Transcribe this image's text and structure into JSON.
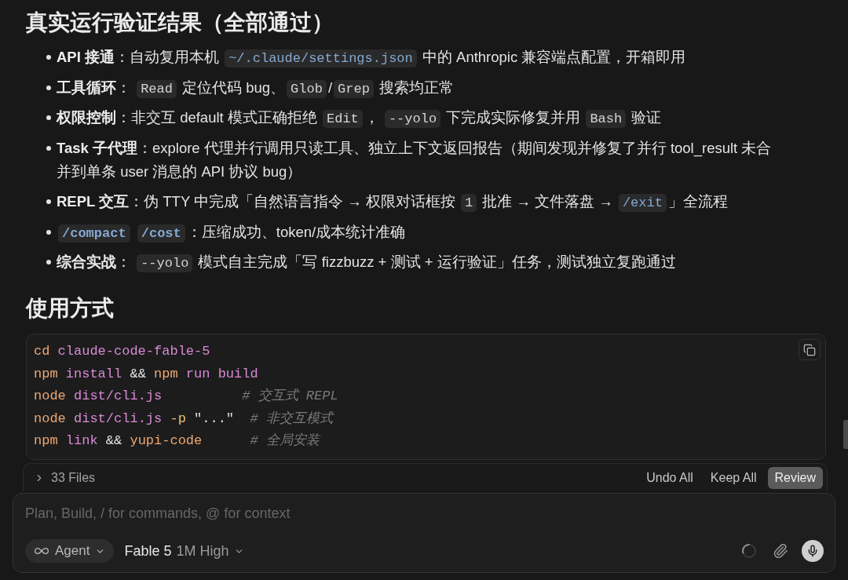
{
  "results": {
    "heading": "真实运行验证结果（全部通过）",
    "items": [
      {
        "segments": [
          {
            "kind": "label",
            "text": "API 接通"
          },
          {
            "kind": "text",
            "text": "：自动复用本机 "
          },
          {
            "kind": "code",
            "text": "~/.claude/settings.json",
            "accent": true
          },
          {
            "kind": "text",
            "text": " 中的 Anthropic 兼容端点配置，开箱即用"
          }
        ]
      },
      {
        "segments": [
          {
            "kind": "label",
            "text": "工具循环"
          },
          {
            "kind": "text",
            "text": "： "
          },
          {
            "kind": "code",
            "text": "Read",
            "accent": false
          },
          {
            "kind": "text",
            "text": " 定位代码 bug、"
          },
          {
            "kind": "code",
            "text": "Glob",
            "accent": false
          },
          {
            "kind": "text",
            "text": "/"
          },
          {
            "kind": "code",
            "text": "Grep",
            "accent": false
          },
          {
            "kind": "text",
            "text": " 搜索均正常"
          }
        ]
      },
      {
        "segments": [
          {
            "kind": "label",
            "text": "权限控制"
          },
          {
            "kind": "text",
            "text": "：非交互 default 模式正确拒绝 "
          },
          {
            "kind": "code",
            "text": "Edit",
            "accent": false
          },
          {
            "kind": "text",
            "text": "， "
          },
          {
            "kind": "code",
            "text": "--yolo",
            "accent": false
          },
          {
            "kind": "text",
            "text": " 下完成实际修复并用 "
          },
          {
            "kind": "code",
            "text": "Bash",
            "accent": false
          },
          {
            "kind": "text",
            "text": " 验证"
          }
        ]
      },
      {
        "segments": [
          {
            "kind": "label",
            "text": "Task 子代理"
          },
          {
            "kind": "text",
            "text": "：explore 代理并行调用只读工具、独立上下文返回报告（期间发现并修复了并行 tool_result 未合并到单条 user 消息的 API 协议 bug）"
          }
        ]
      },
      {
        "segments": [
          {
            "kind": "label",
            "text": "REPL 交互"
          },
          {
            "kind": "text",
            "text": "：伪 TTY 中完成「自然语言指令 → 权限对话框按 "
          },
          {
            "kind": "code",
            "text": "1",
            "accent": false
          },
          {
            "kind": "text",
            "text": " 批准 → 文件落盘 → "
          },
          {
            "kind": "code",
            "text": "/exit",
            "accent": true
          },
          {
            "kind": "text",
            "text": "」全流程"
          }
        ]
      },
      {
        "segments": [
          {
            "kind": "label_code",
            "text": "/compact",
            "accent": true
          },
          {
            "kind": "label_code",
            "text": "/cost",
            "accent": true
          },
          {
            "kind": "text",
            "text": "：压缩成功、token/成本统计准确"
          }
        ]
      },
      {
        "segments": [
          {
            "kind": "label",
            "text": "综合实战"
          },
          {
            "kind": "text",
            "text": "： "
          },
          {
            "kind": "code",
            "text": "--yolo",
            "accent": false
          },
          {
            "kind": "text",
            "text": " 模式自主完成「写 fizzbuzz + 测试 + 运行验证」任务，测试独立复跑通过"
          }
        ]
      }
    ]
  },
  "usage": {
    "heading": "使用方式",
    "code_block": {
      "lines": [
        {
          "tokens": [
            {
              "kind": "command",
              "text": "cd"
            },
            {
              "kind": "argument",
              "text": " claude-code-fable-5"
            }
          ]
        },
        {
          "tokens": [
            {
              "kind": "command",
              "text": "npm"
            },
            {
              "kind": "argument",
              "text": " install"
            },
            {
              "kind": "operator",
              "text": " &&"
            },
            {
              "kind": "command",
              "text": " npm"
            },
            {
              "kind": "argument",
              "text": " run build"
            }
          ]
        },
        {
          "tokens": [
            {
              "kind": "command",
              "text": "node"
            },
            {
              "kind": "argument",
              "text": " dist/cli.js"
            },
            {
              "kind": "comment",
              "text": "          # 交互式 REPL"
            }
          ]
        },
        {
          "tokens": [
            {
              "kind": "command",
              "text": "node"
            },
            {
              "kind": "argument",
              "text": " dist/cli.js"
            },
            {
              "kind": "flag",
              "text": " -p"
            },
            {
              "kind": "string",
              "text": " \"...\""
            },
            {
              "kind": "comment",
              "text": "  # 非交互模式"
            }
          ]
        },
        {
          "tokens": [
            {
              "kind": "command",
              "text": "npm"
            },
            {
              "kind": "argument",
              "text": " link"
            },
            {
              "kind": "operator",
              "text": " &&"
            },
            {
              "kind": "command",
              "text": " yupi-code"
            },
            {
              "kind": "comment",
              "text": "      # 全局安装"
            }
          ]
        }
      ]
    }
  },
  "changes_bar": {
    "expanded": false,
    "label": "33 Files",
    "actions": [
      {
        "kind": "plain",
        "label": "Undo All"
      },
      {
        "kind": "plain",
        "label": "Keep All"
      },
      {
        "kind": "primary",
        "label": "Review"
      }
    ]
  },
  "composer": {
    "placeholder": "Plan, Build, / for commands, @ for context",
    "mode": "Agent",
    "model": "Fable 5",
    "model_detail": "1M High"
  }
}
